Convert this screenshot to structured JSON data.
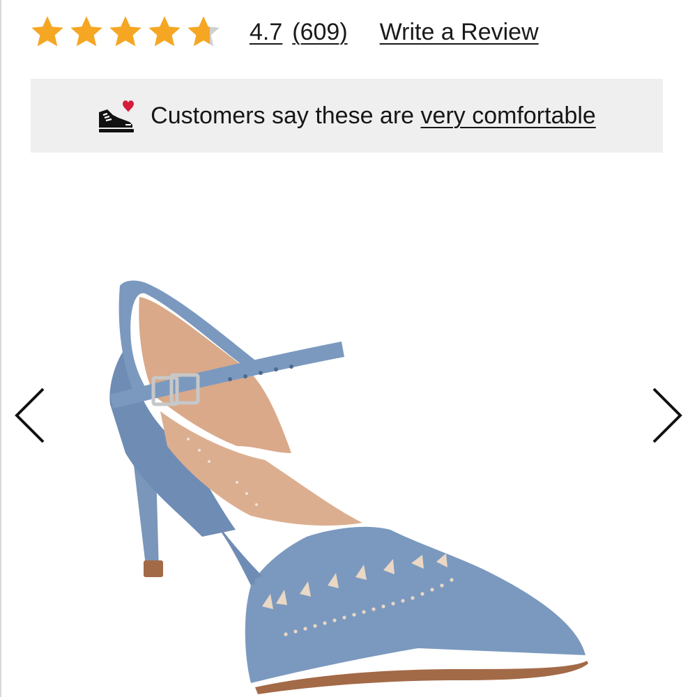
{
  "rating": {
    "stars": 4.7,
    "max_stars": 5,
    "value_label": "4.7",
    "count_label": "(609)",
    "write_review_label": "Write a Review",
    "star_color": "#f5a623",
    "star_empty_color": "#d0d0d0"
  },
  "comfort_banner": {
    "prefix": "Customers say these are ",
    "link_text": "very comfortable",
    "icon": "comfort-shoe-heart-icon",
    "heart_color": "#d41c3b"
  },
  "gallery": {
    "prev_icon": "chevron-left-icon",
    "next_icon": "chevron-right-icon",
    "image": "product-shoe-image",
    "shoe_color": "#7b99bf",
    "insole_color": "#d9a98a"
  }
}
